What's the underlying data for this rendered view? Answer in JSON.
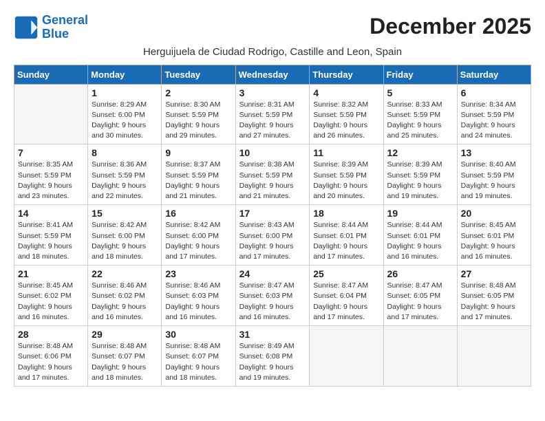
{
  "header": {
    "logo_line1": "General",
    "logo_line2": "Blue",
    "month_title": "December 2025",
    "location": "Herguijuela de Ciudad Rodrigo, Castille and Leon, Spain"
  },
  "weekdays": [
    "Sunday",
    "Monday",
    "Tuesday",
    "Wednesday",
    "Thursday",
    "Friday",
    "Saturday"
  ],
  "weeks": [
    [
      {
        "day": "",
        "info": ""
      },
      {
        "day": "1",
        "info": "Sunrise: 8:29 AM\nSunset: 6:00 PM\nDaylight: 9 hours\nand 30 minutes."
      },
      {
        "day": "2",
        "info": "Sunrise: 8:30 AM\nSunset: 5:59 PM\nDaylight: 9 hours\nand 29 minutes."
      },
      {
        "day": "3",
        "info": "Sunrise: 8:31 AM\nSunset: 5:59 PM\nDaylight: 9 hours\nand 27 minutes."
      },
      {
        "day": "4",
        "info": "Sunrise: 8:32 AM\nSunset: 5:59 PM\nDaylight: 9 hours\nand 26 minutes."
      },
      {
        "day": "5",
        "info": "Sunrise: 8:33 AM\nSunset: 5:59 PM\nDaylight: 9 hours\nand 25 minutes."
      },
      {
        "day": "6",
        "info": "Sunrise: 8:34 AM\nSunset: 5:59 PM\nDaylight: 9 hours\nand 24 minutes."
      }
    ],
    [
      {
        "day": "7",
        "info": "Sunrise: 8:35 AM\nSunset: 5:59 PM\nDaylight: 9 hours\nand 23 minutes."
      },
      {
        "day": "8",
        "info": "Sunrise: 8:36 AM\nSunset: 5:59 PM\nDaylight: 9 hours\nand 22 minutes."
      },
      {
        "day": "9",
        "info": "Sunrise: 8:37 AM\nSunset: 5:59 PM\nDaylight: 9 hours\nand 21 minutes."
      },
      {
        "day": "10",
        "info": "Sunrise: 8:38 AM\nSunset: 5:59 PM\nDaylight: 9 hours\nand 21 minutes."
      },
      {
        "day": "11",
        "info": "Sunrise: 8:39 AM\nSunset: 5:59 PM\nDaylight: 9 hours\nand 20 minutes."
      },
      {
        "day": "12",
        "info": "Sunrise: 8:39 AM\nSunset: 5:59 PM\nDaylight: 9 hours\nand 19 minutes."
      },
      {
        "day": "13",
        "info": "Sunrise: 8:40 AM\nSunset: 5:59 PM\nDaylight: 9 hours\nand 19 minutes."
      }
    ],
    [
      {
        "day": "14",
        "info": "Sunrise: 8:41 AM\nSunset: 5:59 PM\nDaylight: 9 hours\nand 18 minutes."
      },
      {
        "day": "15",
        "info": "Sunrise: 8:42 AM\nSunset: 6:00 PM\nDaylight: 9 hours\nand 18 minutes."
      },
      {
        "day": "16",
        "info": "Sunrise: 8:42 AM\nSunset: 6:00 PM\nDaylight: 9 hours\nand 17 minutes."
      },
      {
        "day": "17",
        "info": "Sunrise: 8:43 AM\nSunset: 6:00 PM\nDaylight: 9 hours\nand 17 minutes."
      },
      {
        "day": "18",
        "info": "Sunrise: 8:44 AM\nSunset: 6:01 PM\nDaylight: 9 hours\nand 17 minutes."
      },
      {
        "day": "19",
        "info": "Sunrise: 8:44 AM\nSunset: 6:01 PM\nDaylight: 9 hours\nand 16 minutes."
      },
      {
        "day": "20",
        "info": "Sunrise: 8:45 AM\nSunset: 6:01 PM\nDaylight: 9 hours\nand 16 minutes."
      }
    ],
    [
      {
        "day": "21",
        "info": "Sunrise: 8:45 AM\nSunset: 6:02 PM\nDaylight: 9 hours\nand 16 minutes."
      },
      {
        "day": "22",
        "info": "Sunrise: 8:46 AM\nSunset: 6:02 PM\nDaylight: 9 hours\nand 16 minutes."
      },
      {
        "day": "23",
        "info": "Sunrise: 8:46 AM\nSunset: 6:03 PM\nDaylight: 9 hours\nand 16 minutes."
      },
      {
        "day": "24",
        "info": "Sunrise: 8:47 AM\nSunset: 6:03 PM\nDaylight: 9 hours\nand 16 minutes."
      },
      {
        "day": "25",
        "info": "Sunrise: 8:47 AM\nSunset: 6:04 PM\nDaylight: 9 hours\nand 17 minutes."
      },
      {
        "day": "26",
        "info": "Sunrise: 8:47 AM\nSunset: 6:05 PM\nDaylight: 9 hours\nand 17 minutes."
      },
      {
        "day": "27",
        "info": "Sunrise: 8:48 AM\nSunset: 6:05 PM\nDaylight: 9 hours\nand 17 minutes."
      }
    ],
    [
      {
        "day": "28",
        "info": "Sunrise: 8:48 AM\nSunset: 6:06 PM\nDaylight: 9 hours\nand 17 minutes."
      },
      {
        "day": "29",
        "info": "Sunrise: 8:48 AM\nSunset: 6:07 PM\nDaylight: 9 hours\nand 18 minutes."
      },
      {
        "day": "30",
        "info": "Sunrise: 8:48 AM\nSunset: 6:07 PM\nDaylight: 9 hours\nand 18 minutes."
      },
      {
        "day": "31",
        "info": "Sunrise: 8:49 AM\nSunset: 6:08 PM\nDaylight: 9 hours\nand 19 minutes."
      },
      {
        "day": "",
        "info": ""
      },
      {
        "day": "",
        "info": ""
      },
      {
        "day": "",
        "info": ""
      }
    ]
  ]
}
